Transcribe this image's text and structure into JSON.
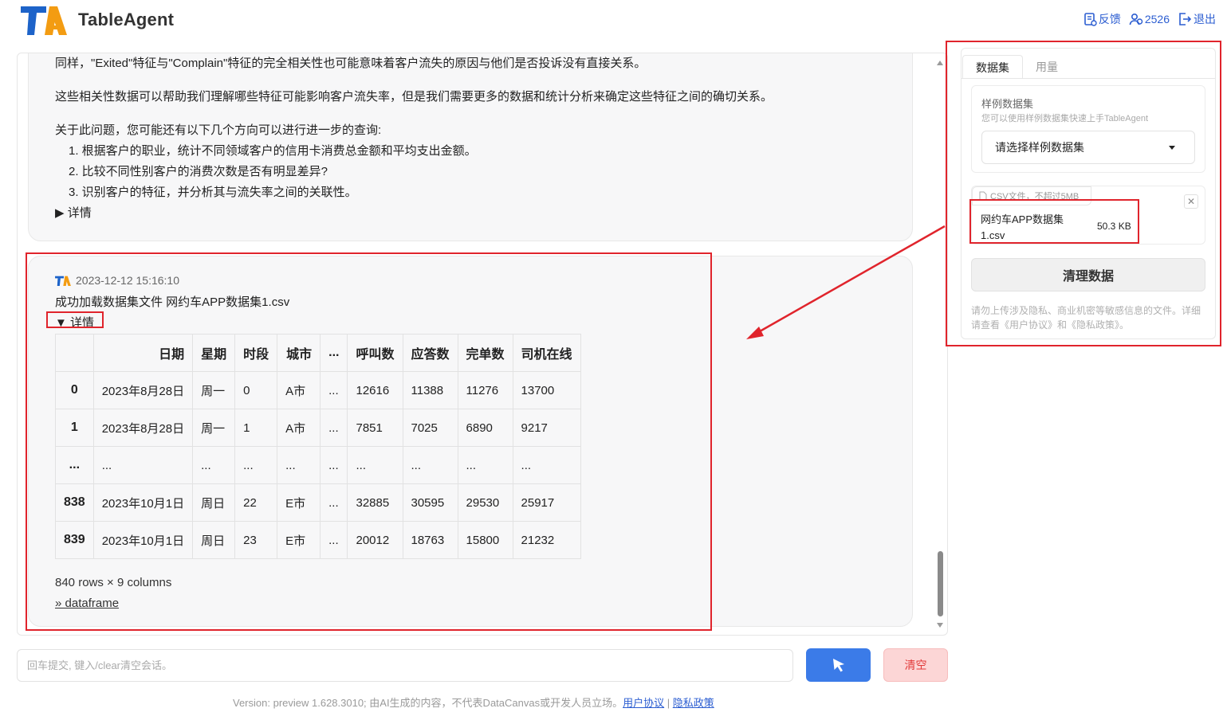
{
  "header": {
    "logo_small": "Table Agent",
    "logo_text": "TableAgent",
    "feedback": "反馈",
    "user_count": "2526",
    "logout": "退出"
  },
  "messages": {
    "m1_line1": "同样，\"Exited\"特征与\"Complain\"特征的完全相关性也可能意味着客户流失的原因与他们是否投诉没有直接关系。",
    "m1_line2": "这些相关性数据可以帮助我们理解哪些特征可能影响客户流失率，但是我们需要更多的数据和统计分析来确定这些特征之间的确切关系。",
    "m1_line3": "关于此问题，您可能还有以下几个方向可以进行进一步的查询:",
    "m1_items": [
      "1. 根据客户的职业，统计不同领域客户的信用卡消费总金额和平均支出金额。",
      "2. 比较不同性别客户的消费次数是否有明显差异?",
      "3. 识别客户的特征，并分析其与流失率之间的关联性。"
    ],
    "m1_details": "▶ 详情",
    "m2_time": "2023-12-12 15:16:10",
    "m2_title": "成功加载数据集文件 网约车APP数据集1.csv",
    "m2_details": "▼ 详情",
    "m2_shape": "840 rows × 9 columns",
    "m2_link": "» dataframe"
  },
  "table": {
    "headers": [
      "",
      "日期",
      "星期",
      "时段",
      "城市",
      "...",
      "呼叫数",
      "应答数",
      "完单数",
      "司机在线"
    ],
    "rows": [
      [
        "0",
        "2023年8月28日",
        "周一",
        "0",
        "A市",
        "...",
        "12616",
        "11388",
        "11276",
        "13700"
      ],
      [
        "1",
        "2023年8月28日",
        "周一",
        "1",
        "A市",
        "...",
        "7851",
        "7025",
        "6890",
        "9217"
      ],
      [
        "...",
        "...",
        "...",
        "...",
        "...",
        "...",
        "...",
        "...",
        "...",
        "..."
      ],
      [
        "838",
        "2023年10月1日",
        "周日",
        "22",
        "E市",
        "...",
        "32885",
        "30595",
        "29530",
        "25917"
      ],
      [
        "839",
        "2023年10月1日",
        "周日",
        "23",
        "E市",
        "...",
        "20012",
        "18763",
        "15800",
        "21232"
      ]
    ]
  },
  "side": {
    "tab_dataset": "数据集",
    "tab_usage": "用量",
    "sample_title": "样例数据集",
    "sample_sub": "您可以使用样例数据集快速上手TableAgent",
    "select_placeholder": "请选择样例数据集",
    "file_hint": "CSV文件，不超过5MB",
    "file_name": "网约车APP数据集1.csv",
    "file_size": "50.3 KB",
    "clear_data": "清理数据",
    "disclaimer": "请勿上传涉及隐私、商业机密等敏感信息的文件。详细请查看《用户协议》和《隐私政策》。"
  },
  "input": {
    "placeholder": "回车提交, 键入/clear清空会话。",
    "clear_label": "清空"
  },
  "footer": {
    "text": "Version: preview 1.628.3010; 由AI生成的内容，不代表DataCanvas或开发人员立场。",
    "user_agreement": "用户协议",
    "separator": "|",
    "privacy": "隐私政策"
  },
  "colors": {
    "accent": "#3b7be8",
    "logo_blue": "#1d63c9",
    "logo_orange": "#f39c12",
    "annotation_red": "#e0242c"
  }
}
